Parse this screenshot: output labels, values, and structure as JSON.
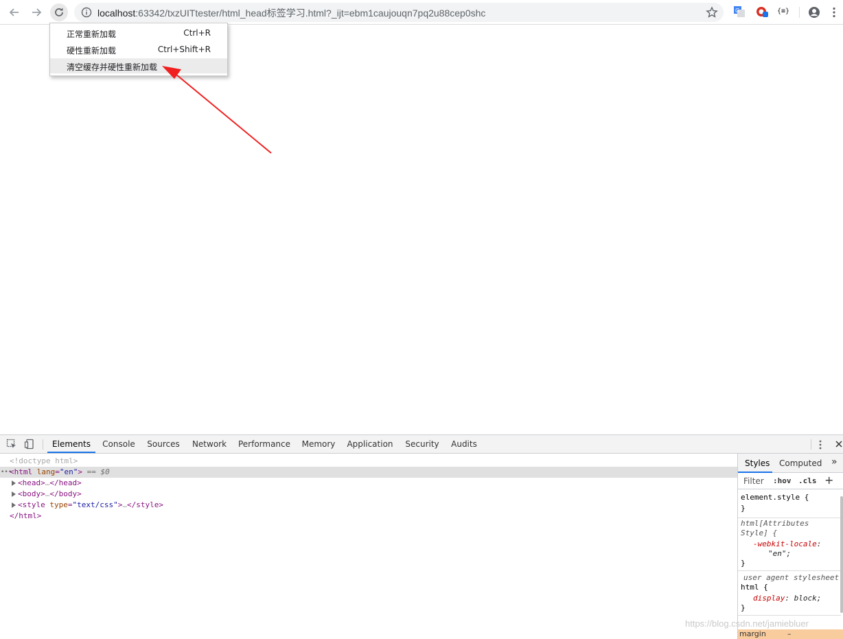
{
  "browser": {
    "url_host": "localhost",
    "url_rest": ":63342/txzUITtester/html_head标签学习.html?_ijt=ebm1caujouqn7pq2u88cep0shc",
    "ext_label": "{≡}"
  },
  "reload_menu": {
    "items": [
      {
        "label": "正常重新加载",
        "shortcut": "Ctrl+R"
      },
      {
        "label": "硬性重新加载",
        "shortcut": "Ctrl+Shift+R"
      },
      {
        "label": "清空缓存并硬性重新加载",
        "shortcut": ""
      }
    ]
  },
  "devtools": {
    "tabs": [
      "Elements",
      "Console",
      "Sources",
      "Network",
      "Performance",
      "Memory",
      "Application",
      "Security",
      "Audits"
    ],
    "elements": {
      "doctype": "<!doctype html>",
      "sel_dots": "•••",
      "html_open_tag": "<html",
      "lang_attr": " lang",
      "lang_eq": "=",
      "lang_value": "\"en\"",
      "close_bracket": ">",
      "eq_marker": " == $0",
      "head_open": "<head>",
      "ellipsis": "…",
      "head_close": "</head>",
      "body_open": "<body>",
      "body_close": "</body>",
      "style_open": "<style",
      "type_attr": " type",
      "type_value": "\"text/css\"",
      "style_close": "</style>",
      "html_close": "</html>"
    },
    "styles": {
      "tabs": [
        "Styles",
        "Computed"
      ],
      "more": "»",
      "filter_placeholder": "Filter",
      "hov": ":hov",
      "cls": ".cls",
      "add": "+",
      "element_style": "element.style {",
      "close_brace": "}",
      "rule1_selector_a": "html[Attributes",
      "rule1_selector_b": "Style] {",
      "rule1_prop": "-webkit-locale",
      "rule1_colon": ":",
      "rule1_value": "\"en\";",
      "ua_label": "user agent stylesheet",
      "rule2_selector": "html {",
      "rule2_prop": "display",
      "rule2_value": ": block;",
      "margin_label": "margin",
      "margin_value": "–"
    }
  },
  "watermark": "https://blog.csdn.net/jamiebluer"
}
